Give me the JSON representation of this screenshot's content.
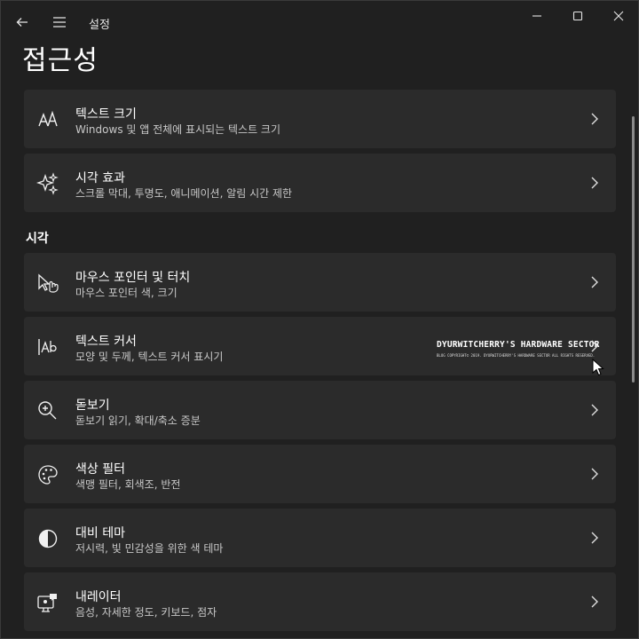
{
  "app": {
    "title": "설정"
  },
  "page": {
    "title": "접근성"
  },
  "section": {
    "vision_label": "시각"
  },
  "cards": [
    {
      "title": "텍스트 크기",
      "subtitle": "Windows 및 앱 전체에 표시되는 텍스트 크기",
      "icon": "text-size-icon"
    },
    {
      "title": "시각 효과",
      "subtitle": "스크롤 막대, 투명도, 애니메이션, 알림 시간 제한",
      "icon": "sparkle-icon"
    },
    {
      "title": "마우스 포인터 및 터치",
      "subtitle": "마우스 포인터 색, 크기",
      "icon": "pointer-touch-icon"
    },
    {
      "title": "텍스트 커서",
      "subtitle": "모양 및 두께, 텍스트 커서 표시기",
      "icon": "text-cursor-icon"
    },
    {
      "title": "돋보기",
      "subtitle": "돋보기 읽기, 확대/축소 증분",
      "icon": "magnifier-icon"
    },
    {
      "title": "색상 필터",
      "subtitle": "색맹 필터, 회색조, 반전",
      "icon": "palette-icon"
    },
    {
      "title": "대비 테마",
      "subtitle": "저시력, 빛 민감성을 위한 색 테마",
      "icon": "contrast-icon"
    },
    {
      "title": "내레이터",
      "subtitle": "음성, 자세한 정도, 키보드, 점자",
      "icon": "narrator-icon"
    }
  ],
  "watermark": {
    "main": "DYURWITCHERRY'S HARDWARE SECTOR",
    "sub": "BLOG COPYRIGHT© 2019. DYURWITCHERRY'S HARDWARE SECTOR ALL RIGHTS RESERVED."
  },
  "colors": {
    "background": "#202020",
    "card": "#2b2b2b",
    "text": "#ffffff",
    "subtext": "#c8c8c8"
  }
}
